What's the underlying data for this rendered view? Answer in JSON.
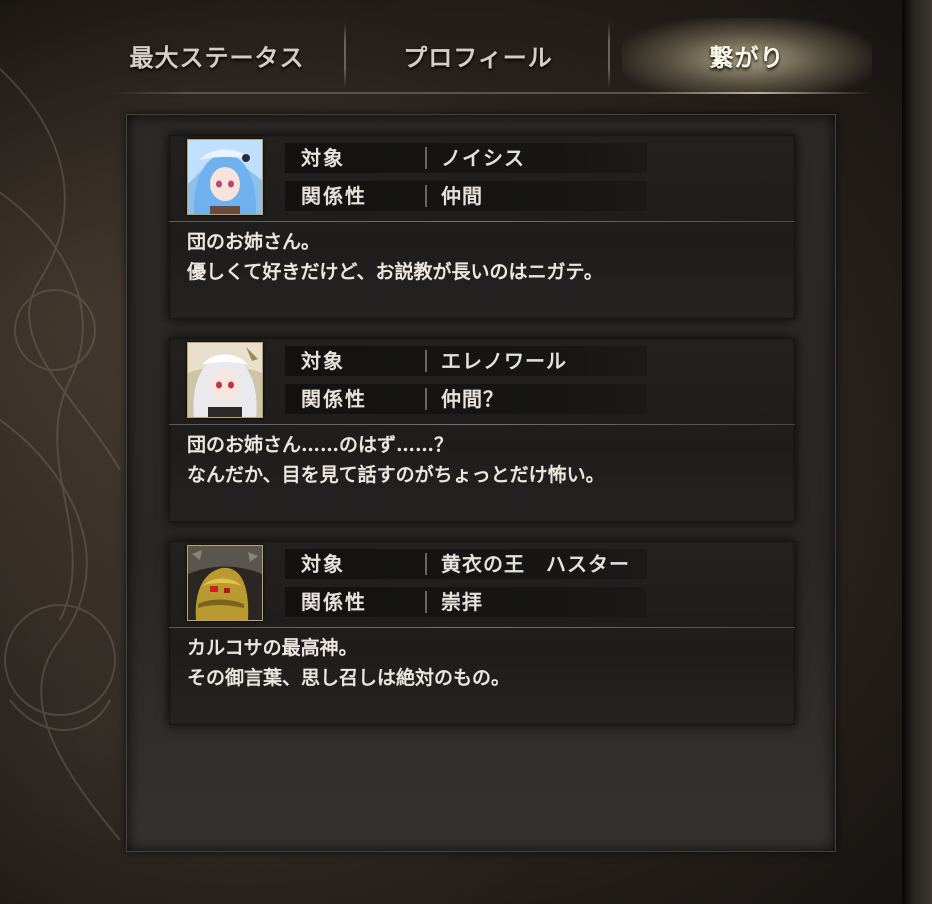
{
  "tabs": [
    {
      "label": "最大ステータス",
      "active": false
    },
    {
      "label": "プロフィール",
      "active": false
    },
    {
      "label": "繋がり",
      "active": true
    }
  ],
  "field_labels": {
    "target": "対象",
    "relation": "関係性"
  },
  "connections": [
    {
      "target": "ノイシス",
      "relation": "仲間",
      "avatar": "blue-haired-girl-portrait",
      "lines": [
        "団のお姉さん。",
        "優しくて好きだけど、お説教が長いのはニガテ。"
      ]
    },
    {
      "target": "エレノワール",
      "relation": "仲間？",
      "avatar": "white-haired-girl-portrait",
      "lines": [
        "団のお姉さん……のはず……？",
        "なんだか、目を見て話すのがちょっとだけ怖い。"
      ]
    },
    {
      "target": "黄衣の王　ハスター",
      "relation": "崇拝",
      "avatar": "golden-king-in-yellow-portrait",
      "lines": [
        "カルコサの最高神。",
        "その御言葉、思し召しは絶対のもの。"
      ]
    }
  ],
  "colors": {
    "accent_gold": "#b9a46e",
    "text": "#e6e1da"
  }
}
